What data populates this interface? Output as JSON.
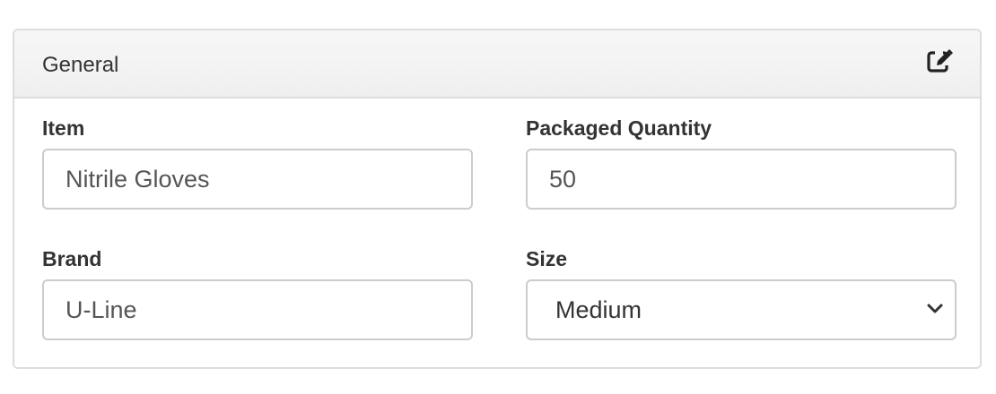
{
  "panel": {
    "title": "General",
    "edit_icon": "edit-icon"
  },
  "fields": {
    "item": {
      "label": "Item",
      "value": "Nitrile Gloves"
    },
    "packaged_quantity": {
      "label": "Packaged Quantity",
      "value": "50"
    },
    "brand": {
      "label": "Brand",
      "value": "U-Line"
    },
    "size": {
      "label": "Size",
      "value": "Medium",
      "options_visible": [
        "Medium"
      ]
    }
  },
  "colors": {
    "border": "#dddddd",
    "input_border": "#cccccc",
    "text": "#333333",
    "input_text": "#555555",
    "heading_bg": "#f5f5f5"
  }
}
